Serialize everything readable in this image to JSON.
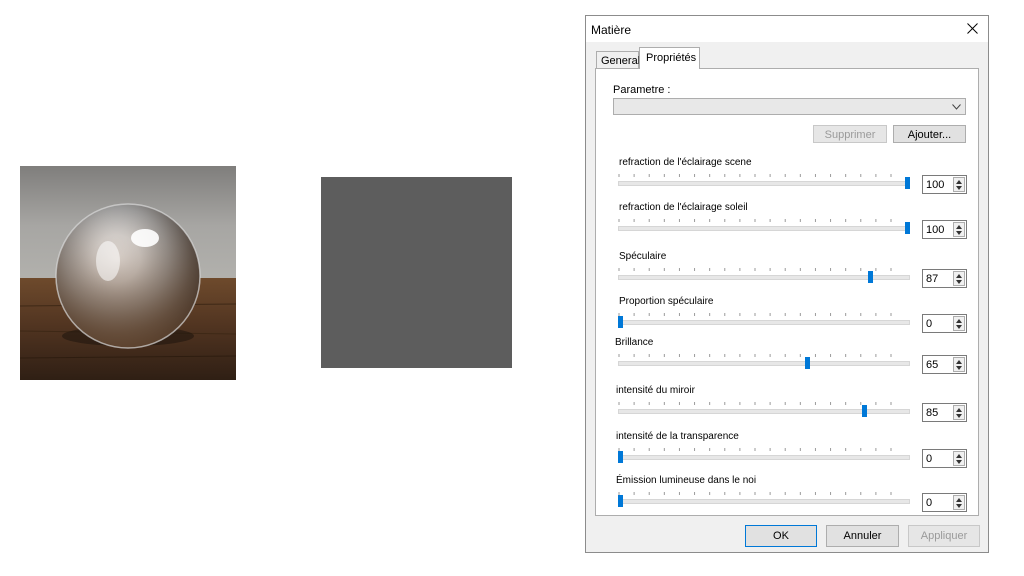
{
  "dialog": {
    "title": "Matière",
    "close_glyph": "×"
  },
  "tabs": [
    {
      "label": "General",
      "active": false
    },
    {
      "label": "Propriétés",
      "active": true
    }
  ],
  "parameter": {
    "label": "Parametre :",
    "selected": ""
  },
  "actions": {
    "delete_label": "Supprimer",
    "add_label": "Ajouter..."
  },
  "sliders": [
    {
      "label": "refraction de l'éclairage scene",
      "value": "100"
    },
    {
      "label": "refraction de l'éclairage soleil",
      "value": "100"
    },
    {
      "label": "Spéculaire",
      "value": "87"
    },
    {
      "label": "Proportion spéculaire",
      "value": "0"
    },
    {
      "label": "Brillance",
      "value": "65"
    },
    {
      "label": "intensité du miroir",
      "value": "85"
    },
    {
      "label": "intensité de la transparence",
      "value": "0"
    },
    {
      "label": "Émission lumineuse dans le noi",
      "value": "0"
    }
  ],
  "footer": {
    "ok_label": "OK",
    "cancel_label": "Annuler",
    "apply_label": "Appliquer"
  },
  "colors": {
    "accent": "#0078d7",
    "flat_preview": "#5d5d5d",
    "wood": "#5a3a22",
    "wall": "#a09f9c"
  },
  "icons": {
    "close": "close-icon",
    "dropdown": "chevron-down-icon",
    "spin": "spin-arrows-icon"
  }
}
